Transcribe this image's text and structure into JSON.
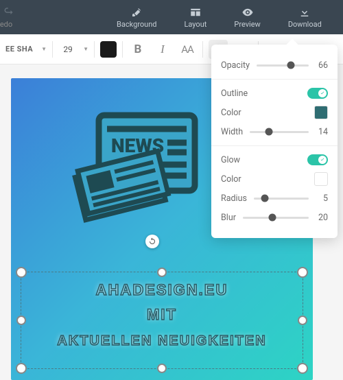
{
  "topbar": {
    "redo_partial": "edo",
    "background": "Background",
    "layout": "Layout",
    "preview": "Preview",
    "download": "Download"
  },
  "toolbar": {
    "font_name": "EE SHA",
    "font_size": "29",
    "text_color": "#1a1a1a"
  },
  "canvas": {
    "news_label": "NEWS",
    "text_line1": "AHADESIGN.EU",
    "text_line2": "MIT",
    "text_line3": "AKTUELLEN NEUIGKEITEN"
  },
  "effects": {
    "opacity": {
      "label": "Opacity",
      "value": "66",
      "pct": 66
    },
    "outline": {
      "label": "Outline",
      "enabled": true,
      "color_label": "Color",
      "color": "#2f6d72",
      "width_label": "Width",
      "width": "14",
      "width_pct": 32
    },
    "glow": {
      "label": "Glow",
      "enabled": true,
      "color_label": "Color",
      "color": "#ffffff",
      "radius_label": "Radius",
      "radius": "5",
      "radius_pct": 20,
      "blur_label": "Blur",
      "blur": "20",
      "blur_pct": 45
    }
  }
}
